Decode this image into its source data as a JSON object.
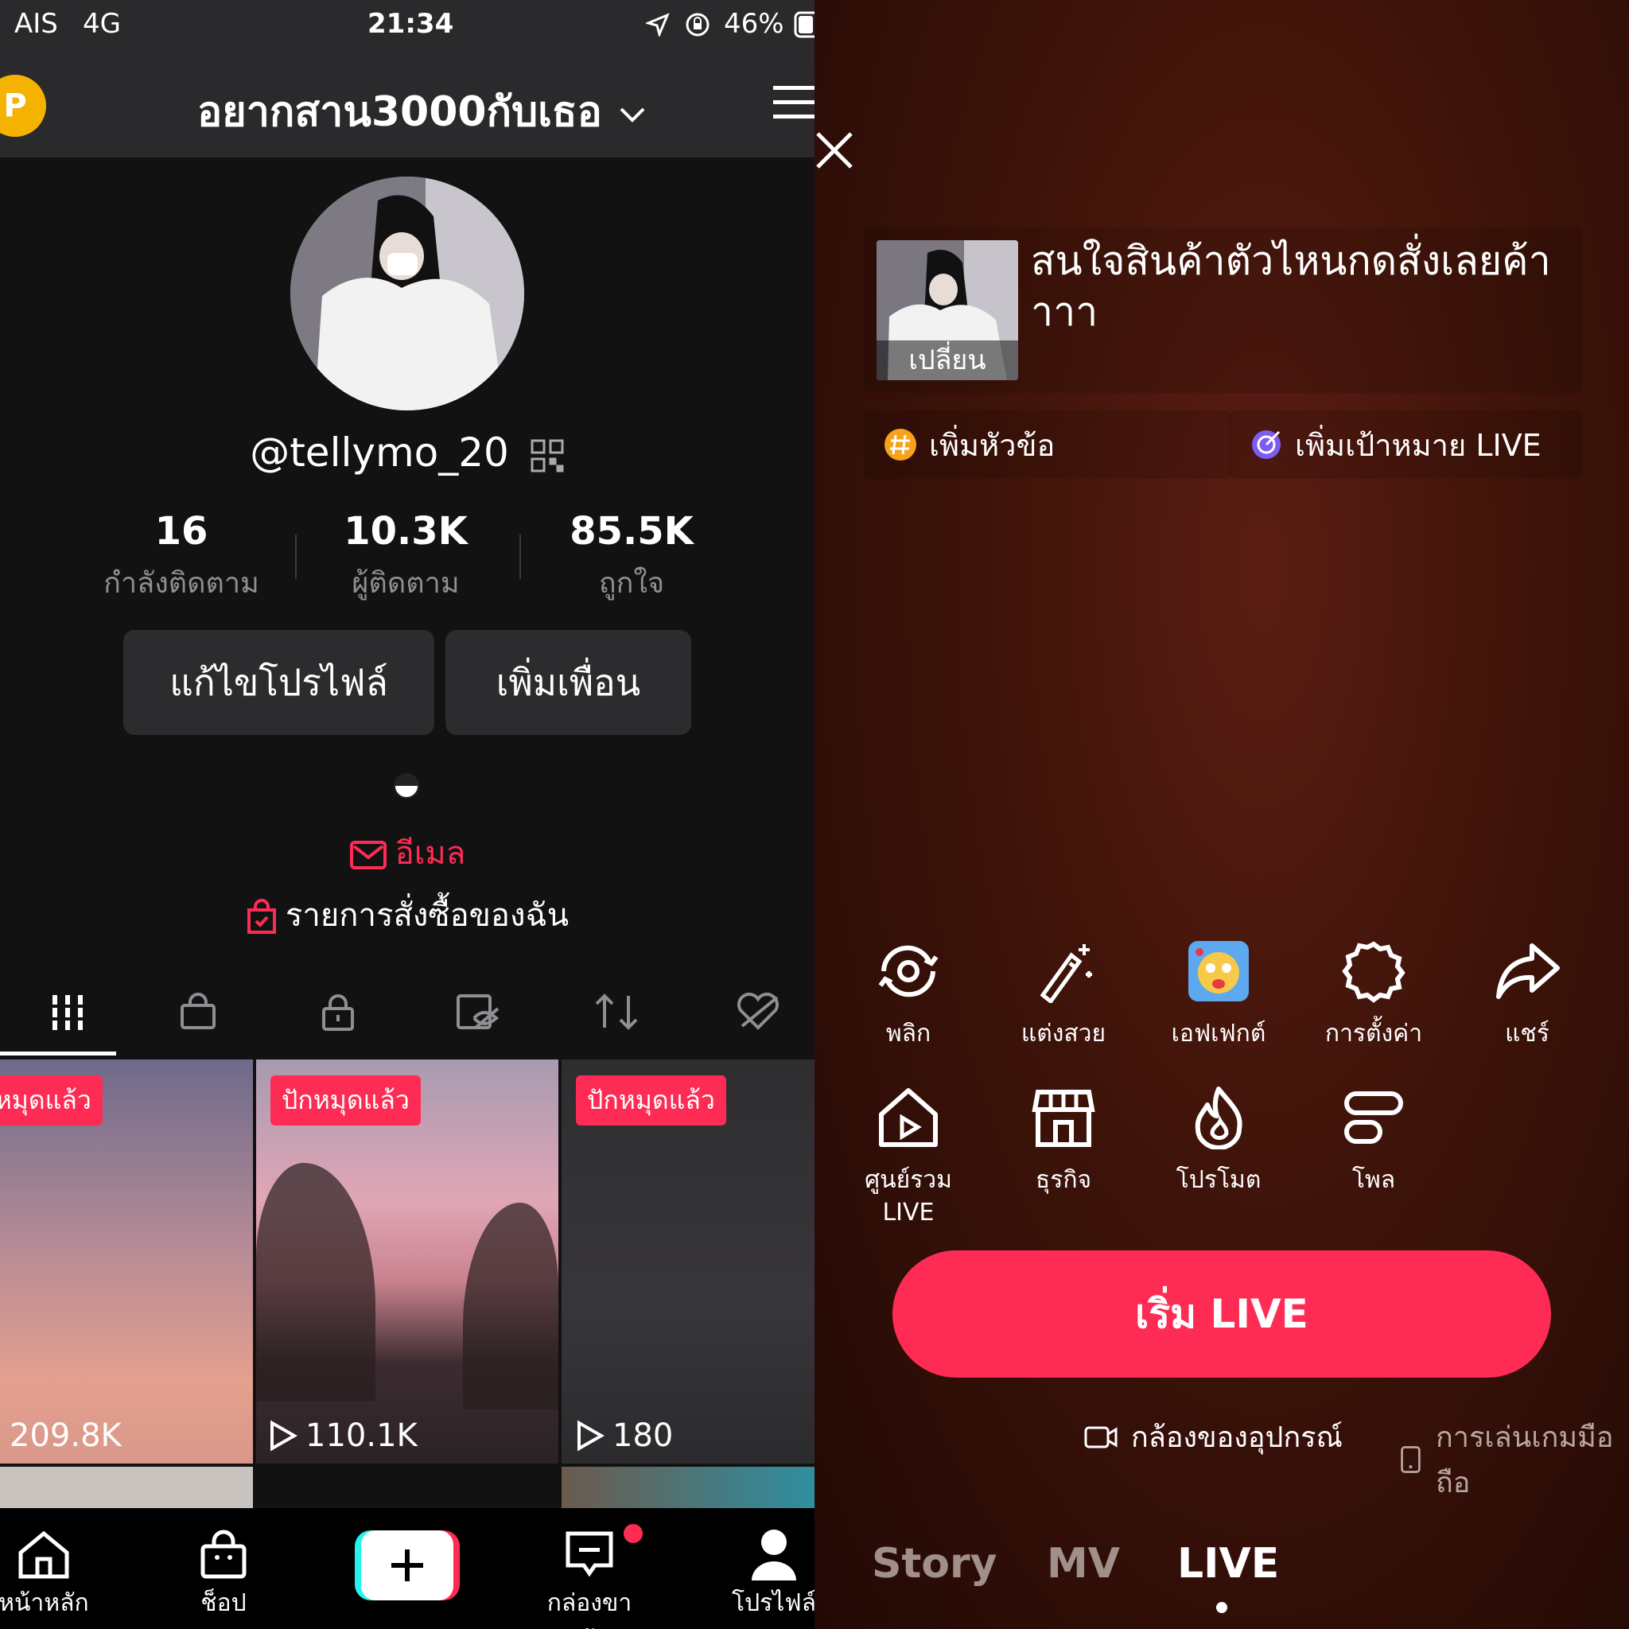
{
  "status_bar": {
    "carrier": "AIS",
    "network": "4G",
    "time": "21:34",
    "battery": "46%"
  },
  "profile": {
    "account_name": "อยากสาน3000กับเธอ",
    "username": "@tellymo_20",
    "stats": [
      {
        "value": "16",
        "label": "กำลังติดตาม"
      },
      {
        "value": "10.3K",
        "label": "ผู้ติดตาม"
      },
      {
        "value": "85.5K",
        "label": "ถูกใจ"
      }
    ],
    "edit_profile": "แก้ไขโปรไฟล์",
    "add_friend": "เพิ่มเพื่อน",
    "email": "อีเมล",
    "orders": "รายการสั่งซื้อของฉัน"
  },
  "videos": [
    {
      "badge": "ปักหมุดแล้ว",
      "views": "209.8K"
    },
    {
      "badge": "ปักหมุดแล้ว",
      "views": "110.1K"
    },
    {
      "badge": "ปักหมุดแล้ว",
      "views": "180"
    }
  ],
  "bottom_nav": [
    {
      "label": "หน้าหลัก"
    },
    {
      "label": "ช็อป"
    },
    {
      "label": ""
    },
    {
      "label": "กล่องขาเข้า"
    },
    {
      "label": "โปรไฟล์"
    }
  ],
  "live": {
    "cover_label": "เปลี่ยน",
    "title": "สนใจสินค้าตัวไหนกดสั่งเลยค้าาาา",
    "add_topic": "เพิ่มหัวข้อ",
    "add_goal": "เพิ่มเป้าหมาย LIVE",
    "tools_row1": [
      "พลิก",
      "แต่งสวย",
      "เอฟเฟกต์",
      "การตั้งค่า",
      "แชร์"
    ],
    "tools_row2": [
      "ศูนย์รวม LIVE",
      "ธุรกิจ",
      "โปรโมต",
      "โพล"
    ],
    "start_button": "เริ่ม LIVE",
    "source_camera": "กล้องของอุปกรณ์",
    "source_game": "การเล่นเกมมือถือ",
    "modes": [
      "Story",
      "MV",
      "LIVE"
    ]
  },
  "colors": {
    "accent": "#fe2c55",
    "panel": "#2a2a2c",
    "live_bg": "#3d1309"
  }
}
